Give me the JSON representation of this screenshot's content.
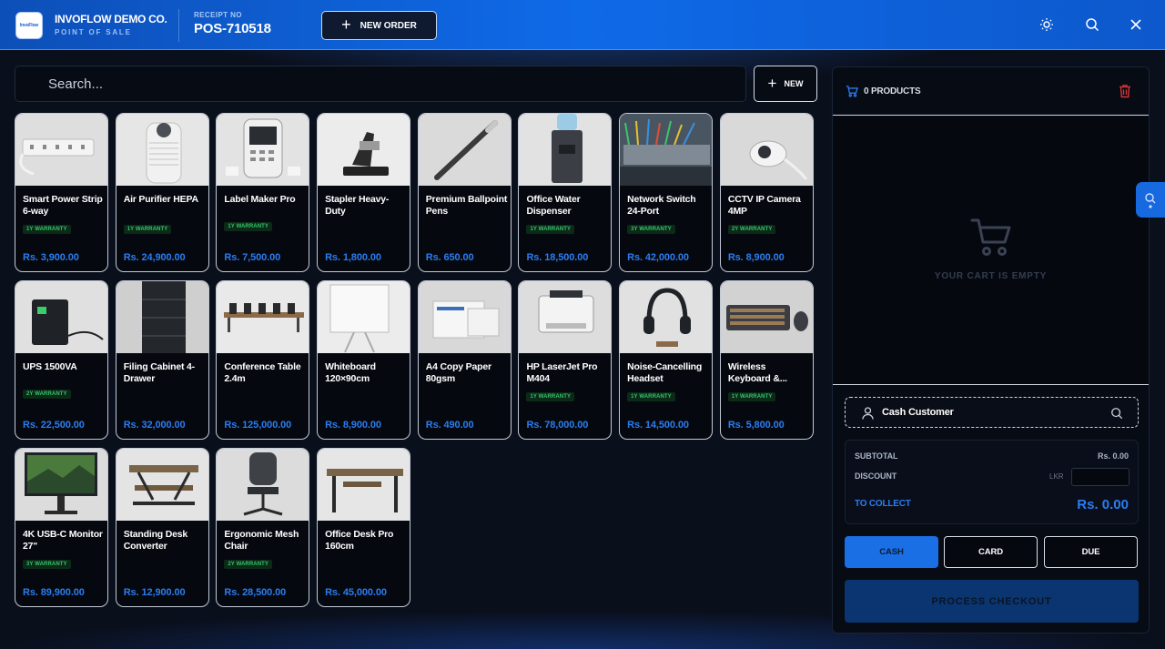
{
  "header": {
    "logo_text": "InvoFlow",
    "company_name": "INVOFLOW DEMO CO.",
    "company_sub": "POINT OF SALE",
    "receipt_label": "RECEIPT NO",
    "receipt_no": "POS-710518",
    "new_order_label": "NEW ORDER",
    "icons": [
      "sun-icon",
      "search-icon",
      "close-icon"
    ]
  },
  "search": {
    "placeholder": "Search...",
    "new_label": "NEW"
  },
  "products": [
    {
      "name": "Smart Power Strip 6-way",
      "warranty": "1Y WARRANTY",
      "price": "Rs. 3,900.00",
      "image": "power-strip"
    },
    {
      "name": "Air Purifier HEPA",
      "warranty": "1Y WARRANTY",
      "price": "Rs. 24,900.00",
      "image": "air-purifier"
    },
    {
      "name": "Label Maker Pro",
      "warranty": "1Y WARRANTY",
      "price": "Rs. 7,500.00",
      "image": "label-maker"
    },
    {
      "name": "Stapler Heavy-Duty",
      "warranty": "",
      "price": "Rs. 1,800.00",
      "image": "stapler"
    },
    {
      "name": "Premium Ballpoint Pens",
      "warranty": "",
      "price": "Rs. 650.00",
      "image": "pen"
    },
    {
      "name": "Office Water Dispenser",
      "warranty": "1Y WARRANTY",
      "price": "Rs. 18,500.00",
      "image": "water-dispenser"
    },
    {
      "name": "Network Switch 24-Port",
      "warranty": "3Y WARRANTY",
      "price": "Rs. 42,000.00",
      "image": "network-switch"
    },
    {
      "name": "CCTV IP Camera 4MP",
      "warranty": "2Y WARRANTY",
      "price": "Rs. 8,900.00",
      "image": "cctv"
    },
    {
      "name": "UPS 1500VA",
      "warranty": "2Y WARRANTY",
      "price": "Rs. 22,500.00",
      "image": "ups"
    },
    {
      "name": "Filing Cabinet 4-Drawer",
      "warranty": "",
      "price": "Rs. 32,000.00",
      "image": "cabinet"
    },
    {
      "name": "Conference Table 2.4m",
      "warranty": "",
      "price": "Rs. 125,000.00",
      "image": "table"
    },
    {
      "name": "Whiteboard 120×90cm",
      "warranty": "",
      "price": "Rs. 8,900.00",
      "image": "whiteboard"
    },
    {
      "name": "A4 Copy Paper 80gsm",
      "warranty": "",
      "price": "Rs. 490.00",
      "image": "paper"
    },
    {
      "name": "HP LaserJet Pro M404",
      "warranty": "1Y WARRANTY",
      "price": "Rs. 78,000.00",
      "image": "printer"
    },
    {
      "name": "Noise-Cancelling Headset",
      "warranty": "1Y WARRANTY",
      "price": "Rs. 14,500.00",
      "image": "headset"
    },
    {
      "name": "Wireless Keyboard &...",
      "warranty": "1Y WARRANTY",
      "price": "Rs. 5,800.00",
      "image": "keyboard"
    },
    {
      "name": "4K USB-C Monitor 27\"",
      "warranty": "3Y WARRANTY",
      "price": "Rs. 89,900.00",
      "image": "monitor"
    },
    {
      "name": "Standing Desk Converter",
      "warranty": "",
      "price": "Rs. 12,900.00",
      "image": "desk-converter"
    },
    {
      "name": "Ergonomic Mesh Chair",
      "warranty": "2Y WARRANTY",
      "price": "Rs. 28,500.00",
      "image": "chair"
    },
    {
      "name": "Office Desk Pro 160cm",
      "warranty": "",
      "price": "Rs. 45,000.00",
      "image": "desk"
    }
  ],
  "cart": {
    "count_label": "0 PRODUCTS",
    "empty_text": "YOUR CART IS EMPTY",
    "customer": "Cash Customer",
    "subtotal_label": "SUBTOTAL",
    "subtotal": "Rs. 0.00",
    "discount_label": "DISCOUNT",
    "currency": "LKR",
    "collect_label": "TO COLLECT",
    "collect": "Rs. 0.00",
    "pay_methods": [
      "CASH",
      "CARD",
      "DUE"
    ],
    "selected_pay": "CASH",
    "checkout_label": "PROCESS CHECKOUT"
  },
  "colors": {
    "accent": "#2b7df0",
    "header": "#0f6ae8",
    "warranty": "#35c46a",
    "danger": "#e03a3a"
  }
}
